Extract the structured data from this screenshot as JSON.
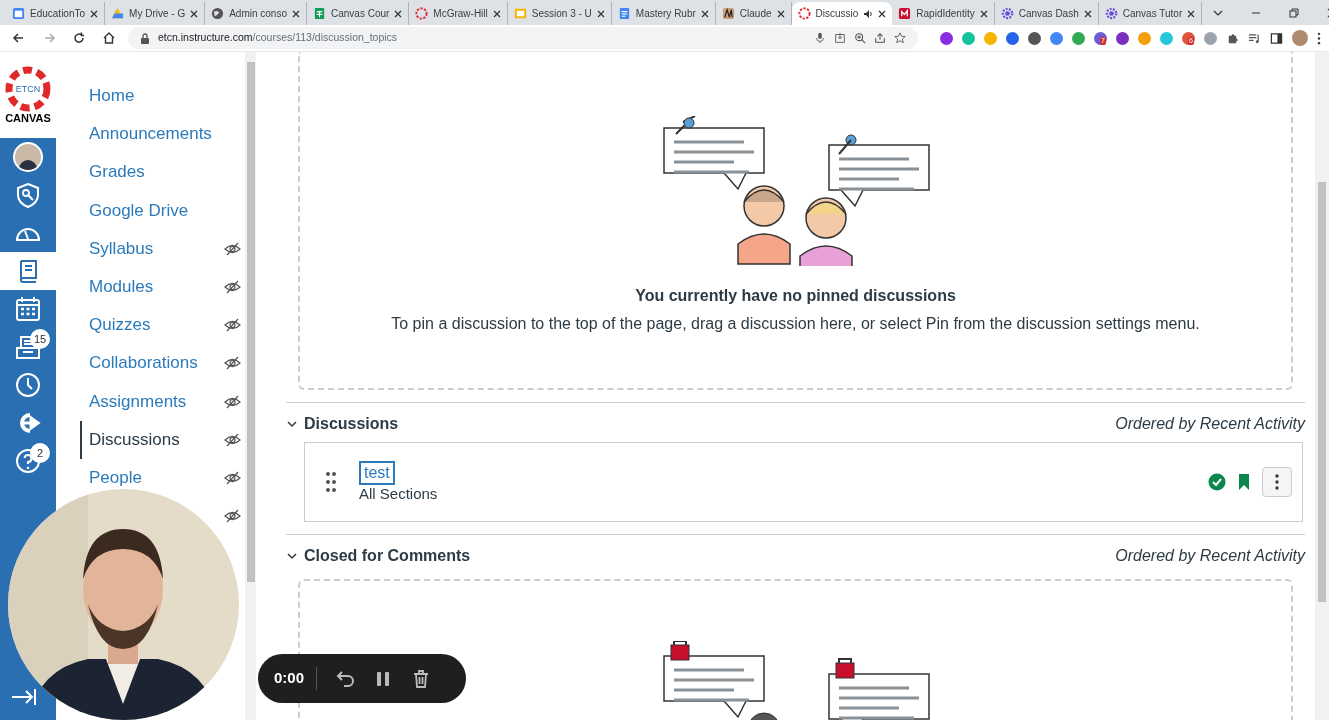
{
  "browser": {
    "tabs": [
      {
        "title": "EducationTo",
        "selected": false,
        "audio": false
      },
      {
        "title": "My Drive - G",
        "selected": false,
        "audio": false
      },
      {
        "title": "Admin conso",
        "selected": false,
        "audio": false
      },
      {
        "title": "Canvas Cour",
        "selected": false,
        "audio": false
      },
      {
        "title": "McGraw-Hill",
        "selected": false,
        "audio": false
      },
      {
        "title": "Session 3 - U",
        "selected": false,
        "audio": false
      },
      {
        "title": "Mastery Rubr",
        "selected": false,
        "audio": false
      },
      {
        "title": "Claude",
        "selected": false,
        "audio": false
      },
      {
        "title": "Discussio",
        "selected": true,
        "audio": true
      },
      {
        "title": "RapidIdentity",
        "selected": false,
        "audio": false
      },
      {
        "title": "Canvas Dash",
        "selected": false,
        "audio": false
      },
      {
        "title": "Canvas Tutor",
        "selected": false,
        "audio": false
      }
    ],
    "url_host": "etcn.instructure.com",
    "url_path": "/courses/113/discussion_topics",
    "extensions": [
      {
        "color": "#8b2be2"
      },
      {
        "color": "#15c39a"
      },
      {
        "color": "#f4b400"
      },
      {
        "color": "#2563eb"
      },
      {
        "color": "#555555"
      },
      {
        "color": "#4285f4"
      },
      {
        "color": "#34a853"
      },
      {
        "color": "#6b5bd6",
        "badge": "7"
      },
      {
        "color": "#7b2fbf"
      },
      {
        "color": "#f59e0b"
      },
      {
        "color": "#26c6da"
      },
      {
        "color": "#e0553a",
        "badge": "6"
      },
      {
        "color": "#9ca3af"
      }
    ]
  },
  "logo": {
    "text": "CANVAS",
    "ring_text": "ETCN"
  },
  "global_nav": [
    {
      "kind": "avatar",
      "selected": false
    },
    {
      "kind": "admin",
      "selected": false
    },
    {
      "kind": "dashboard",
      "selected": false
    },
    {
      "kind": "courses",
      "selected": true
    },
    {
      "kind": "calendar",
      "selected": false
    },
    {
      "kind": "inbox",
      "selected": false,
      "badge": "15"
    },
    {
      "kind": "history",
      "selected": false
    },
    {
      "kind": "commons",
      "selected": false
    },
    {
      "kind": "help",
      "selected": false,
      "badge": "2"
    }
  ],
  "course_nav": [
    {
      "label": "Home",
      "hidden": false,
      "selected": false
    },
    {
      "label": "Announcements",
      "hidden": false,
      "selected": false
    },
    {
      "label": "Grades",
      "hidden": false,
      "selected": false
    },
    {
      "label": "Google Drive",
      "hidden": false,
      "selected": false
    },
    {
      "label": "Syllabus",
      "hidden": true,
      "selected": false
    },
    {
      "label": "Modules",
      "hidden": true,
      "selected": false
    },
    {
      "label": "Quizzes",
      "hidden": true,
      "selected": false
    },
    {
      "label": "Collaborations",
      "hidden": true,
      "selected": false
    },
    {
      "label": "Assignments",
      "hidden": true,
      "selected": false
    },
    {
      "label": "Discussions",
      "hidden": true,
      "selected": true
    },
    {
      "label": "People",
      "hidden": true,
      "selected": false
    },
    {
      "hidden": true
    }
  ],
  "pinned": {
    "title": "You currently have no pinned discussions",
    "text": "To pin a discussion to the top of the page, drag a discussion here, or select Pin from the discussion settings menu."
  },
  "sections": [
    {
      "title": "Discussions",
      "order": "Ordered by Recent Activity",
      "expanded": true,
      "items": [
        {
          "title": "test",
          "subtitle": "All Sections",
          "published": true,
          "subscribed": true
        }
      ]
    },
    {
      "title": "Closed for Comments",
      "order": "Ordered by Recent Activity",
      "expanded": true
    }
  ],
  "recorder": {
    "time": "0:00"
  }
}
